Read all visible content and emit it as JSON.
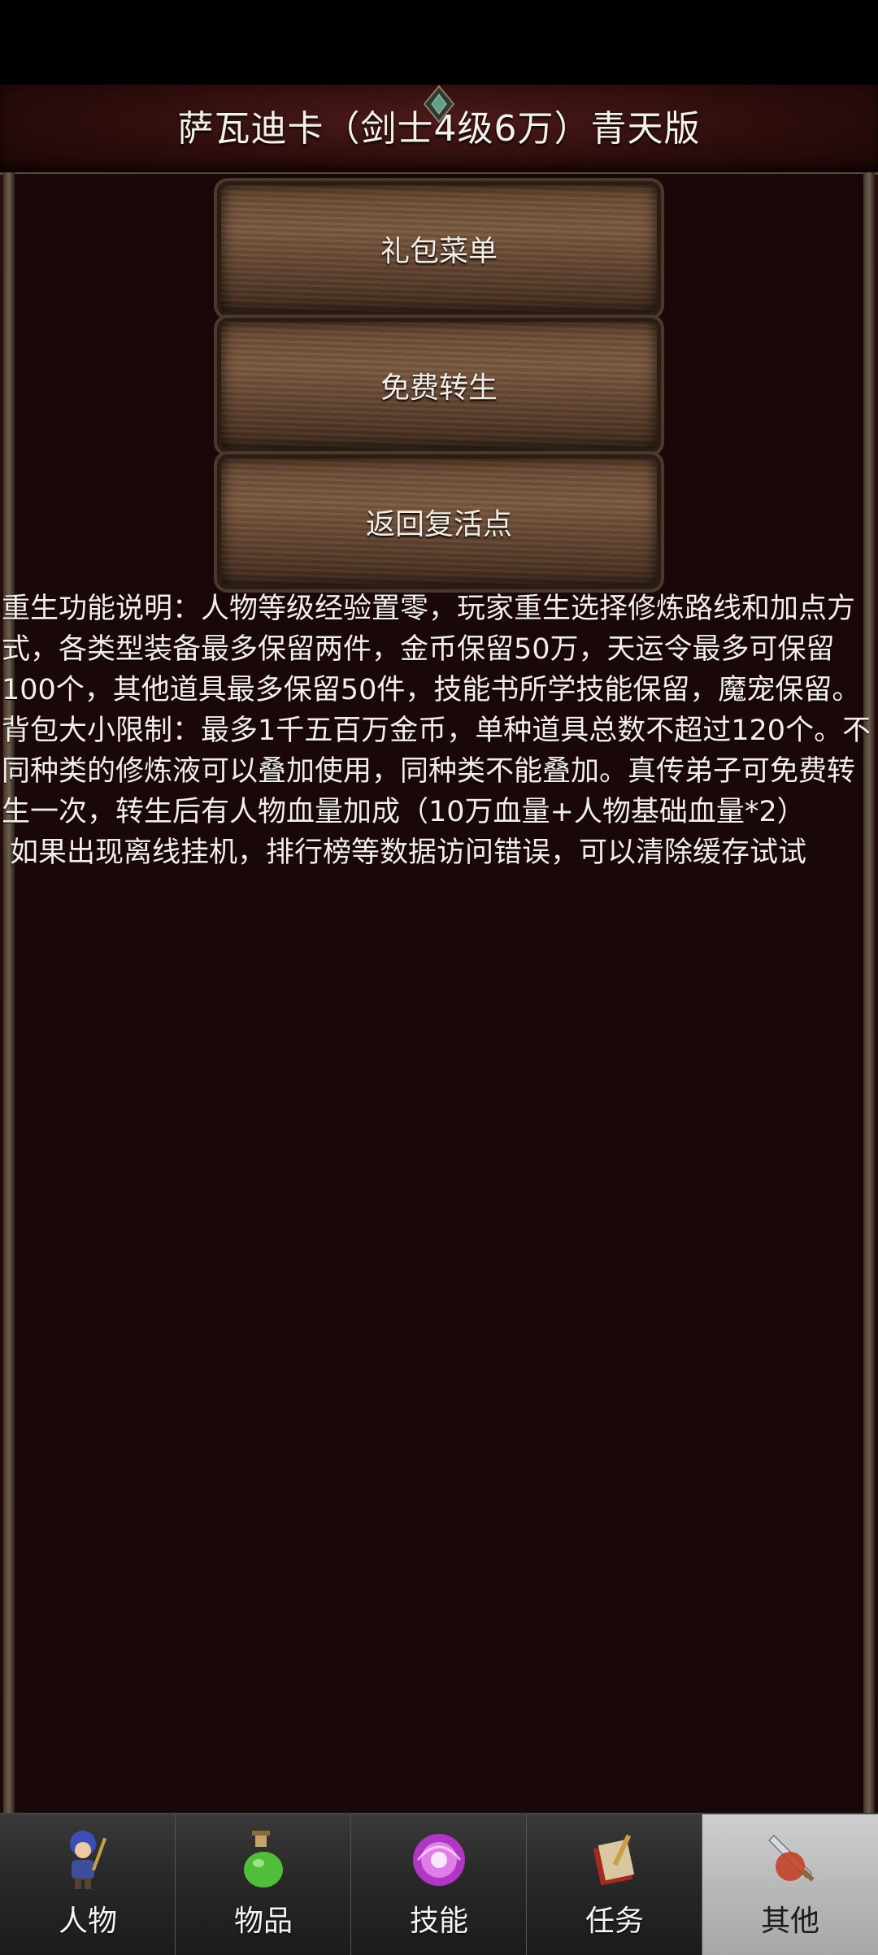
{
  "header": {
    "title": "萨瓦迪卡（剑士4级6万）青天版"
  },
  "menu": {
    "buttons": [
      {
        "label": "礼包菜单"
      },
      {
        "label": "免费转生"
      },
      {
        "label": "返回复活点"
      }
    ]
  },
  "description": {
    "paragraph1": "重生功能说明：人物等级经验置零，玩家重生选择修炼路线和加点方式，各类型装备最多保留两件，金币保留50万，天运令最多可保留100个，其他道具最多保留50件，技能书所学技能保留，魔宠保留。背包大小限制：最多1千五百万金币，单种道具总数不超过120个。不同种类的修炼液可以叠加使用，同种类不能叠加。真传弟子可免费转生一次，转生后有人物血量加成（10万血量+人物基础血量*2）",
    "paragraph2": "如果出现离线挂机，排行榜等数据访问错误，可以清除缓存试试"
  },
  "nav": {
    "items": [
      {
        "label": "人物",
        "icon": "character-icon"
      },
      {
        "label": "物品",
        "icon": "potion-icon"
      },
      {
        "label": "技能",
        "icon": "skill-orb-icon"
      },
      {
        "label": "任务",
        "icon": "quest-book-icon"
      },
      {
        "label": "其他",
        "icon": "other-sword-icon",
        "active": true
      }
    ]
  },
  "colors": {
    "background": "#1a0708",
    "text": "#f3eee8",
    "active_tab": "#bdbdbd"
  }
}
